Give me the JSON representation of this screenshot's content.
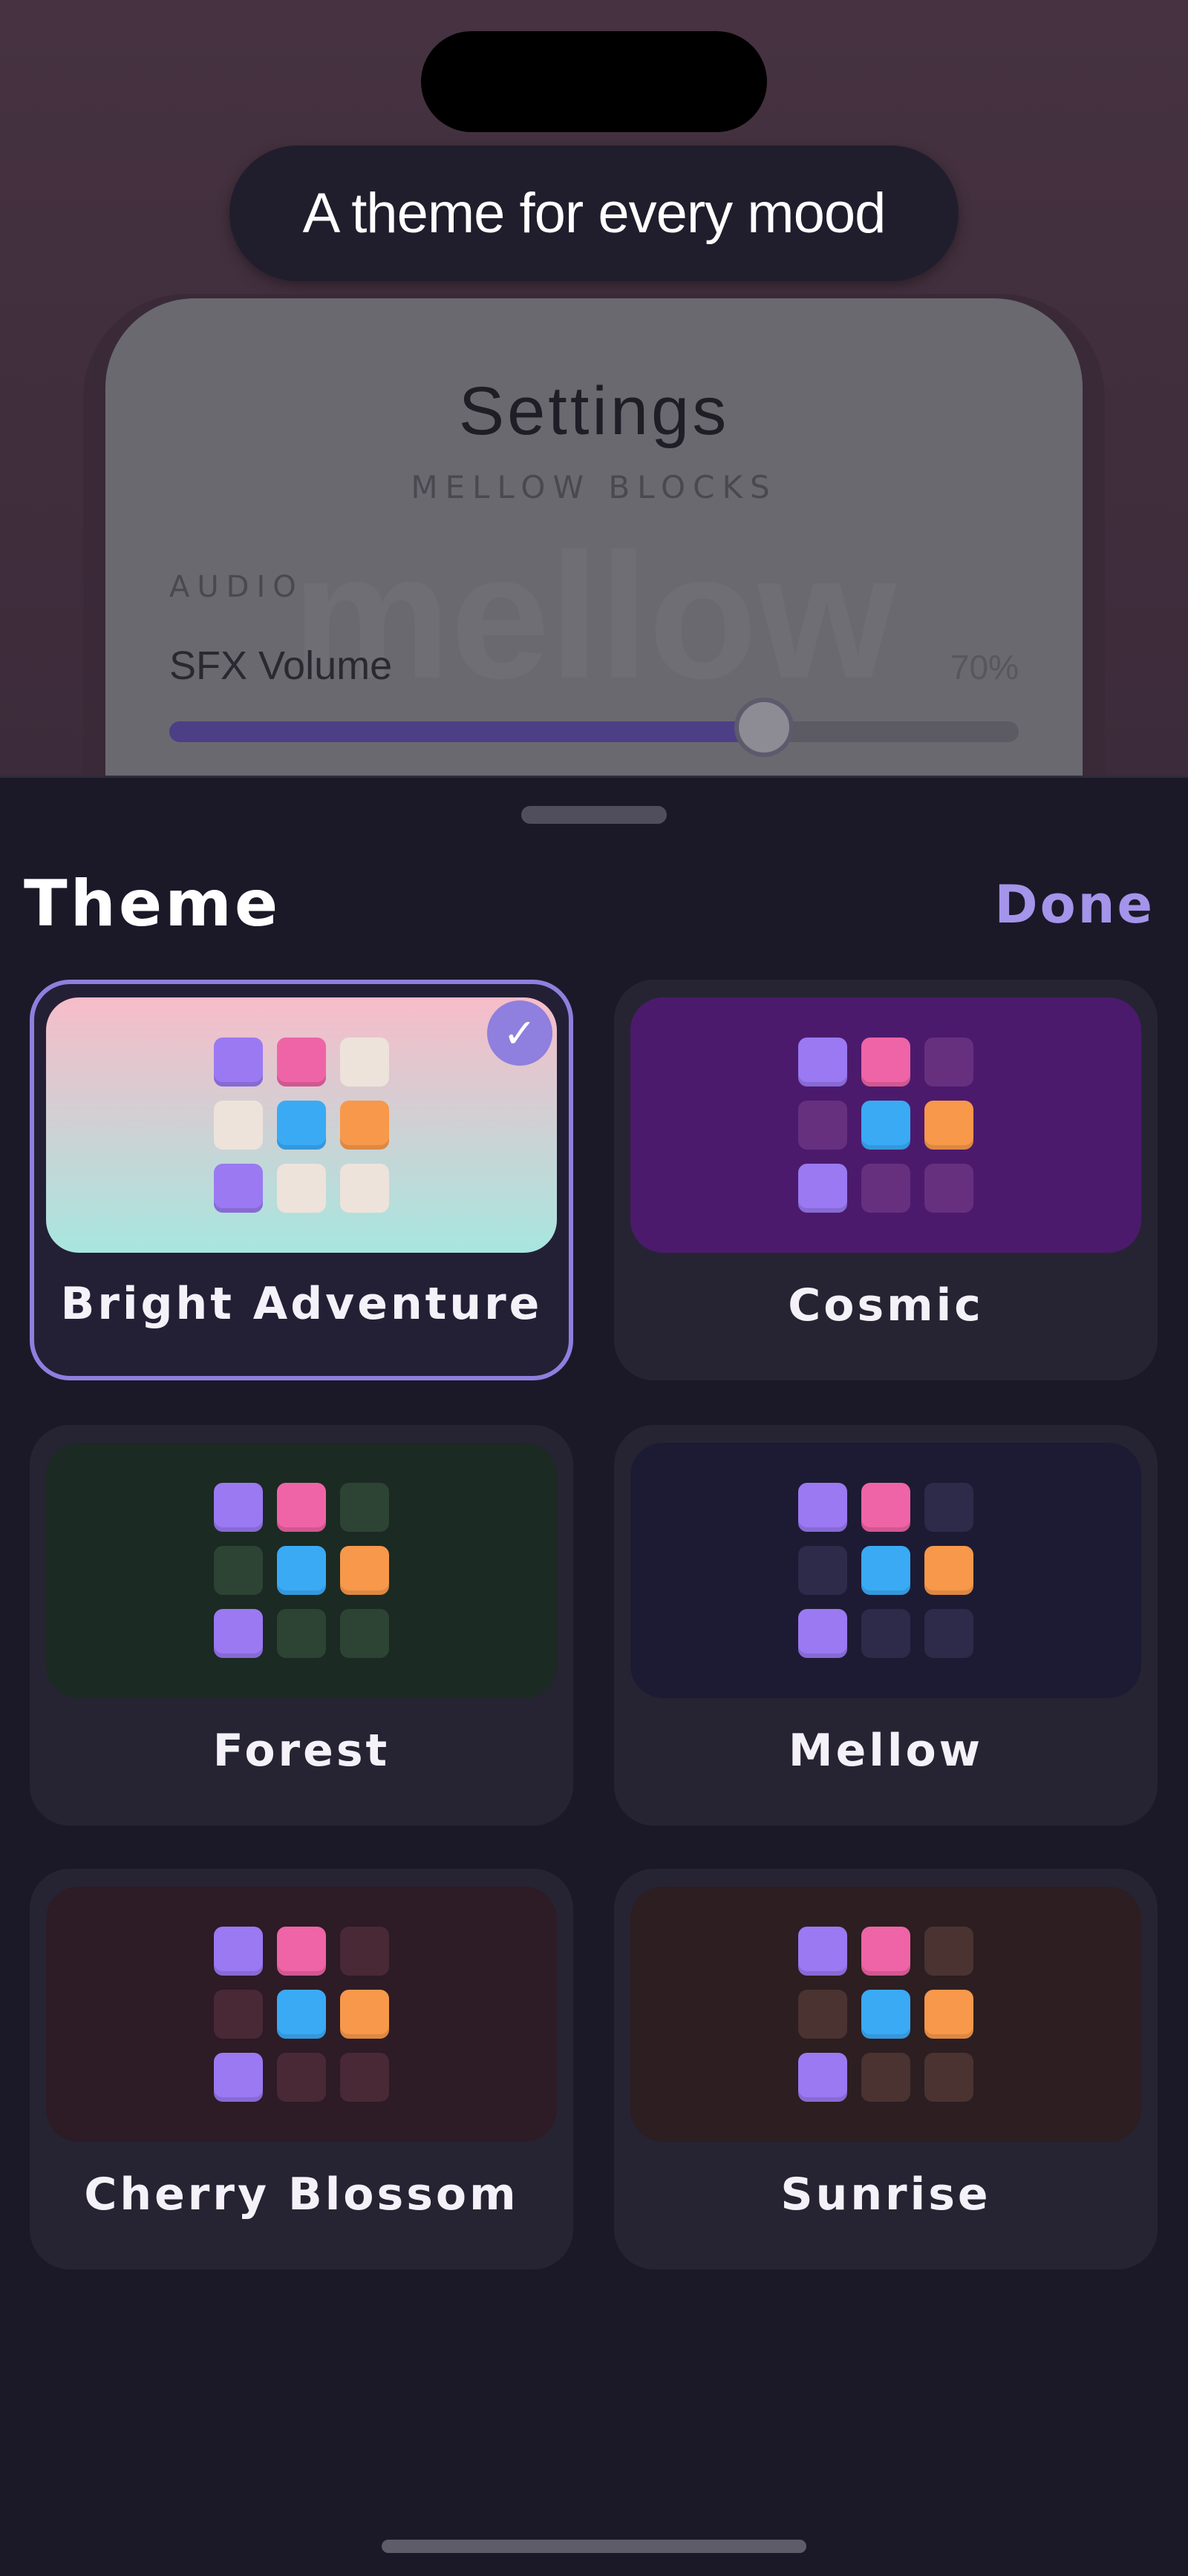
{
  "banner": {
    "text": "A theme for every mood"
  },
  "background_app": {
    "title": "Settings",
    "subtitle": "MELLOW BLOCKS",
    "watermark": "mellow",
    "section": "AUDIO",
    "sfx_label": "SFX Volume",
    "sfx_value_text": "70%",
    "sfx_level": 0.7
  },
  "sheet": {
    "title": "Theme",
    "done_label": "Done",
    "selected_icon": "checkmark-icon"
  },
  "themes": [
    {
      "name": "Bright Adventure",
      "selected": true,
      "preview_bg": "linear-gradient(180deg,#f7bcc9 0%,#a7e6df 100%)",
      "empty_tile": "#ede3da"
    },
    {
      "name": "Cosmic",
      "selected": false,
      "preview_bg": "#4c1a6c",
      "empty_tile": "#66307f"
    },
    {
      "name": "Forest",
      "selected": false,
      "preview_bg": "#1b2a22",
      "empty_tile": "#2d4434"
    },
    {
      "name": "Mellow",
      "selected": false,
      "preview_bg": "#1d1b33",
      "empty_tile": "#2e2a4a"
    },
    {
      "name": "Cherry Blossom",
      "selected": false,
      "preview_bg": "#2d1b25",
      "empty_tile": "#482935"
    },
    {
      "name": "Sunrise",
      "selected": false,
      "preview_bg": "#2c1e21",
      "empty_tile": "#4a3331"
    }
  ],
  "tile_pattern": [
    "purple",
    "pink",
    "empty",
    "empty",
    "blue",
    "orange",
    "purple",
    "empty",
    "empty"
  ],
  "colors": {
    "accent": "#8f7fde",
    "done": "#a494ea",
    "sheet_bg": "#1b1928",
    "card_bg": "#262433"
  }
}
